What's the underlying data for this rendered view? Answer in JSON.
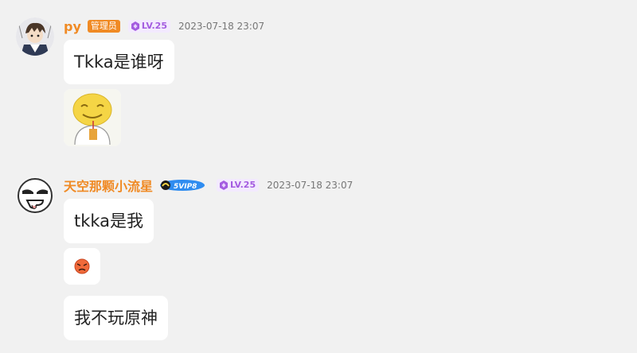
{
  "messages": [
    {
      "username": "py",
      "role_badge": "管理员",
      "level": "LV.25",
      "timestamp": "2023-07-18 23:07",
      "text": "Tkka是谁呀",
      "sticker": "smiley-cup-sticker"
    },
    {
      "username": "天空那颗小流星",
      "vip_badge": "5VIP8",
      "level": "LV.25",
      "timestamp": "2023-07-18 23:07",
      "texts": [
        "tkka是我",
        "我不玩原神"
      ],
      "emoji": "angry-face-emoji"
    }
  ],
  "colors": {
    "background": "#f1f1f1",
    "username": "#f08a24",
    "admin_badge": "#f08a24",
    "level_badge_bg": "#f3eafe",
    "level_badge_text": "#a45ce0"
  }
}
